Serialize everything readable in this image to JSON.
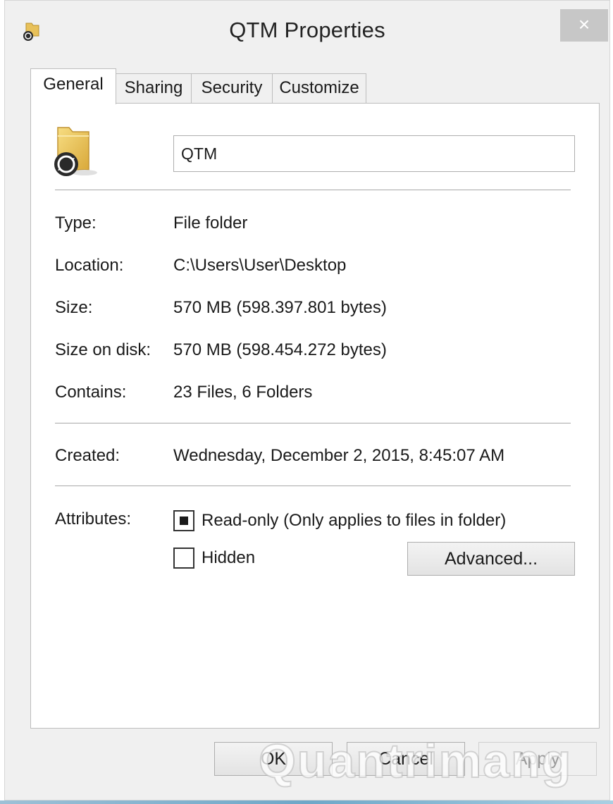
{
  "window": {
    "title": "QTM Properties",
    "close_glyph": "×",
    "title_icon": "folder-sync-icon"
  },
  "tabs": [
    {
      "label": "General",
      "active": true
    },
    {
      "label": "Sharing",
      "active": false
    },
    {
      "label": "Security",
      "active": false
    },
    {
      "label": "Customize",
      "active": false
    }
  ],
  "general": {
    "folder_icon": "folder-sync-icon",
    "name_value": "QTM",
    "properties": {
      "type": {
        "label": "Type:",
        "value": "File folder"
      },
      "location": {
        "label": "Location:",
        "value": "C:\\Users\\User\\Desktop"
      },
      "size": {
        "label": "Size:",
        "value": "570 MB (598.397.801 bytes)"
      },
      "size_on_disk": {
        "label": "Size on disk:",
        "value": "570 MB (598.454.272 bytes)"
      },
      "contains": {
        "label": "Contains:",
        "value": "23 Files, 6 Folders"
      },
      "created": {
        "label": "Created:",
        "value": "Wednesday, December 2, 2015, 8:45:07 AM"
      }
    },
    "attributes": {
      "label": "Attributes:",
      "readonly": {
        "label": "Read-only (Only applies to files in folder)",
        "state": "indeterminate"
      },
      "hidden": {
        "label": "Hidden",
        "checked": false
      },
      "advanced_label": "Advanced..."
    }
  },
  "footer": {
    "ok_label": "OK",
    "cancel_label": "Cancel",
    "apply_label": "Apply"
  },
  "watermark": "Quantrimang"
}
